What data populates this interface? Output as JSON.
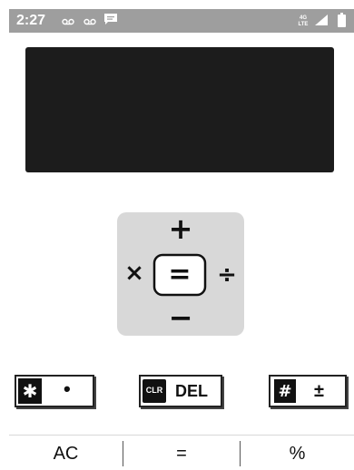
{
  "status_bar": {
    "time": "2:27",
    "icons": [
      "voicemail-icon",
      "voicemail-icon",
      "message-icon",
      "lte-signal-icon",
      "cell-signal-icon",
      "battery-icon"
    ],
    "network_label": "4G LTE"
  },
  "display": {
    "value": ""
  },
  "operator_pad": {
    "plus": "+",
    "multiply": "×",
    "equals": "=",
    "divide": "÷",
    "minus": "−"
  },
  "function_row": {
    "left": {
      "icon_glyph": "✱",
      "label": "•"
    },
    "middle": {
      "icon_text": "CLR",
      "label": "DEL"
    },
    "right": {
      "icon_glyph": "#",
      "label": "±"
    }
  },
  "bottom_bar": {
    "keys": [
      "AC",
      "=",
      "%"
    ]
  },
  "colors": {
    "status_bar_bg": "#9e9e9e",
    "display_bg": "#1c1c1c",
    "operator_pad_bg": "#d8d8d8"
  }
}
